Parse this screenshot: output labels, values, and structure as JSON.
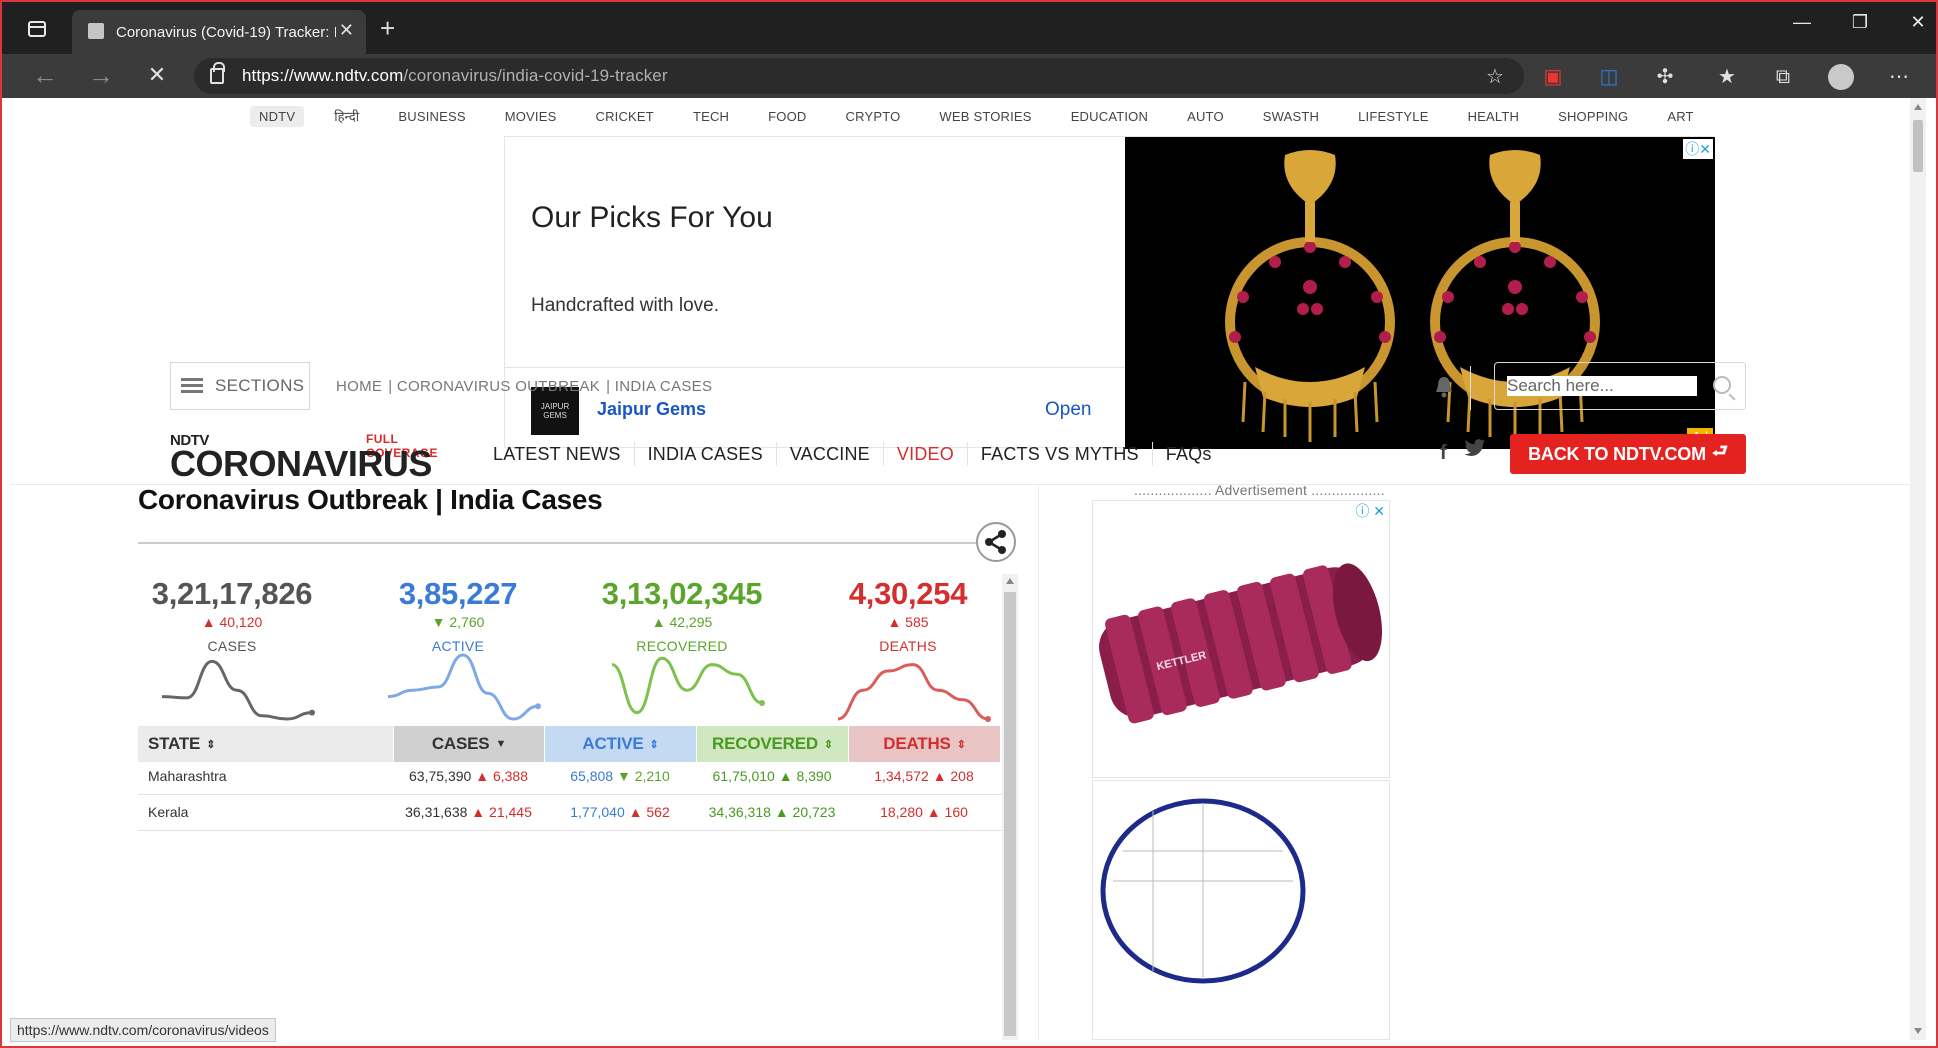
{
  "browser": {
    "tab_title": "Coronavirus (Covid-19) Tracker: I",
    "url_host": "https://www.ndtv.com",
    "url_path": "/coronavirus/india-covid-19-tracker",
    "status_url": "https://www.ndtv.com/coronavirus/videos"
  },
  "topnav": [
    "NDTV",
    "हिन्दी",
    "BUSINESS",
    "MOVIES",
    "CRICKET",
    "TECH",
    "FOOD",
    "CRYPTO",
    "WEB STORIES",
    "EDUCATION",
    "AUTO",
    "SWASTH",
    "LIFESTYLE",
    "HEALTH",
    "SHOPPING",
    "ART"
  ],
  "ad": {
    "title": "Our Picks For You",
    "subtitle": "Handcrafted with love.",
    "brand": "Jaipur Gems",
    "logo_text": "JAIPUR GEMS",
    "cta": "Open",
    "badge": "Ad"
  },
  "header": {
    "sections_label": "SECTIONS",
    "breadcrumb": [
      "HOME",
      "| CORONAVIRUS OUTBREAK",
      "| INDIA CASES"
    ],
    "search_placeholder": "Search here...",
    "logo_top": "NDTV",
    "logo_full": "FULL COVERAGE",
    "logo_main": "CORONAVIRUS",
    "menu": [
      "LATEST NEWS",
      "INDIA CASES",
      "VACCINE",
      "VIDEO",
      "FACTS VS MYTHS",
      "FAQs"
    ],
    "social": {
      "facebook": "f",
      "twitter": "t"
    },
    "back_button": "BACK TO NDTV.COM"
  },
  "content": {
    "heading": "Coronavirus Outbreak | India Cases",
    "stats": [
      {
        "value": "3,21,17,826",
        "delta": "▲ 40,120",
        "label": "CASES",
        "color": "#555555",
        "delta_color": "#d32f2f",
        "trend": [
          0.35,
          0.33,
          0.9,
          0.45,
          0.05,
          0.0,
          0.1
        ]
      },
      {
        "value": "3,85,227",
        "delta": "▼ 2,760",
        "label": "ACTIVE",
        "color": "#3a7bd5",
        "delta_color": "#5ba52b",
        "trend": [
          0.35,
          0.45,
          0.5,
          1.0,
          0.4,
          0.0,
          0.2
        ]
      },
      {
        "value": "3,13,02,345",
        "delta": "▲ 42,295",
        "label": "RECOVERED",
        "color": "#5ba52b",
        "delta_color": "#5ba52b",
        "trend": [
          0.85,
          0.1,
          0.95,
          0.45,
          0.85,
          0.7,
          0.25
        ]
      },
      {
        "value": "4,30,254",
        "delta": "▲ 585",
        "label": "DEATHS",
        "color": "#d32f2f",
        "delta_color": "#d32f2f",
        "trend": [
          0.0,
          0.45,
          0.75,
          0.85,
          0.45,
          0.3,
          0.0
        ]
      }
    ],
    "table": {
      "headers": [
        "STATE",
        "CASES",
        "ACTIVE",
        "RECOVERED",
        "DEATHS"
      ],
      "rows": [
        {
          "state": "Maharashtra",
          "cases": "63,75,390",
          "cases_d": "▲ 6,388",
          "active": "65,808",
          "active_d": "▼ 2,210",
          "recovered": "61,75,010",
          "recovered_d": "▲ 8,390",
          "deaths": "1,34,572",
          "deaths_d": "▲ 208"
        },
        {
          "state": "Kerala",
          "cases": "36,31,638",
          "cases_d": "▲ 21,445",
          "active": "1,77,040",
          "active_d": "▲ 562",
          "recovered": "34,36,318",
          "recovered_d": "▲ 20,723",
          "deaths": "18,280",
          "deaths_d": "▲ 160"
        }
      ]
    }
  },
  "rail": {
    "ad_label": "................... Advertisement ..................",
    "product_brand": "KETTLER"
  },
  "colors": {
    "red": "#e4221f",
    "blue": "#3a7bd5",
    "green": "#5ba52b",
    "header_cases": "#d0d0d0",
    "header_active": "#c4d9f2",
    "header_recovered": "#cfe8bf",
    "header_deaths": "#e8c4c4"
  }
}
